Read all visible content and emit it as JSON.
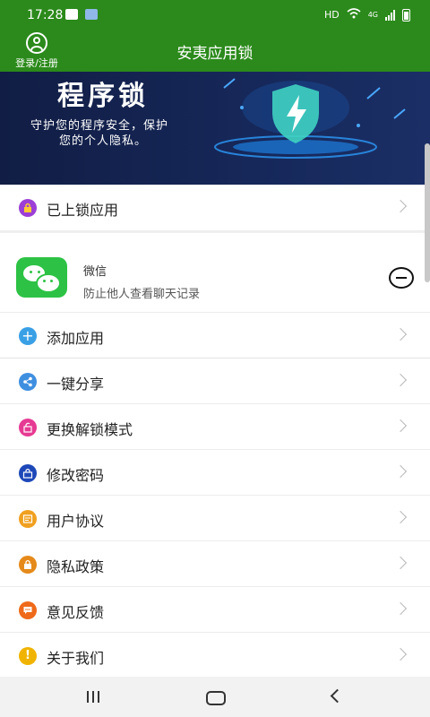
{
  "status_bar": {
    "time": "17:28",
    "network": "HD",
    "cell": "4G"
  },
  "app_bar": {
    "title": "安夷应用锁",
    "login_label": "登录/注册"
  },
  "banner": {
    "heading": "程序锁",
    "line1": "守护您的程序安全，保护",
    "line2": "您的个人隐私。"
  },
  "locked_apps": {
    "label": "已上锁应用",
    "icon": "lock-icon",
    "color": "#9b3fd6"
  },
  "app_item": {
    "name": "微信",
    "description": "防止他人查看聊天记录"
  },
  "menu": [
    {
      "label": "添加应用",
      "icon": "plus-icon",
      "color": "#3aa0e6"
    },
    {
      "label": "一键分享",
      "icon": "share-icon",
      "color": "#3f8fe0"
    },
    {
      "label": "更换解锁模式",
      "icon": "unlock-icon",
      "color": "#e63a93"
    },
    {
      "label": "修改密码",
      "icon": "password-icon",
      "color": "#1e48b8"
    },
    {
      "label": "用户协议",
      "icon": "agreement-icon",
      "color": "#f0a020"
    },
    {
      "label": "隐私政策",
      "icon": "privacy-lock-icon",
      "color": "#e58a1a"
    },
    {
      "label": "意见反馈",
      "icon": "feedback-icon",
      "color": "#ee6a1a"
    },
    {
      "label": "关于我们",
      "icon": "info-icon",
      "color": "#f0b400"
    }
  ]
}
